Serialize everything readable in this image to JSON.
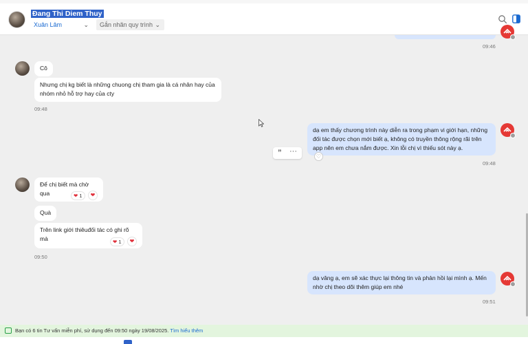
{
  "header": {
    "contact_name": "Đang Thi Diem Thuy",
    "assignee": "Xuân Lâm",
    "tag_button": "Gắn nhãn quy trình",
    "search_icon": "search-icon",
    "panel_icon": "side-panel-icon"
  },
  "messages": [
    {
      "dir": "out",
      "time": "09:46"
    },
    {
      "dir": "in",
      "text": "Cô"
    },
    {
      "dir": "in",
      "text": "Nhưng chị kg biết là những chuong chị tham gia là cá nhân hay của nhóm nhỏ hỗ trợ hay của cty",
      "time": "09:48"
    },
    {
      "dir": "out",
      "text": "dạ em thấy chương trình này diễn ra trong phạm vi giới hạn, những đối tác được chọn mới biết ạ, không có truyền thông rộng rãi trên app nên em chưa nắm được. Xin lỗi chị vì thiếu sót này ạ.",
      "time": "09:48"
    },
    {
      "dir": "in",
      "text": "Để chị biết mà chờ qua",
      "reaction_count": "1"
    },
    {
      "dir": "in",
      "text": "Quà"
    },
    {
      "dir": "in",
      "text": "Trên link giới thiêuđối tác có ghi rõ mà",
      "reaction_count": "1",
      "time": "09:50"
    },
    {
      "dir": "out",
      "text": "dạ vâng ạ, em sẽ xác thực lại thông tin và phản hồi lại mình ạ. Mến nhờ chị theo dõi thêm giúp em nhé",
      "time": "09:51"
    }
  ],
  "banner": {
    "text": "Bạn có 6 tin Tư vấn miễn phí, sử dụng đến 09:50 ngày 19/08/2025.",
    "link": "Tìm hiểu thêm"
  },
  "colors": {
    "out_bubble": "#d7e5fd",
    "in_bubble": "#ffffff",
    "accent": "#2f62c8",
    "banner_bg": "#e3f5de"
  }
}
